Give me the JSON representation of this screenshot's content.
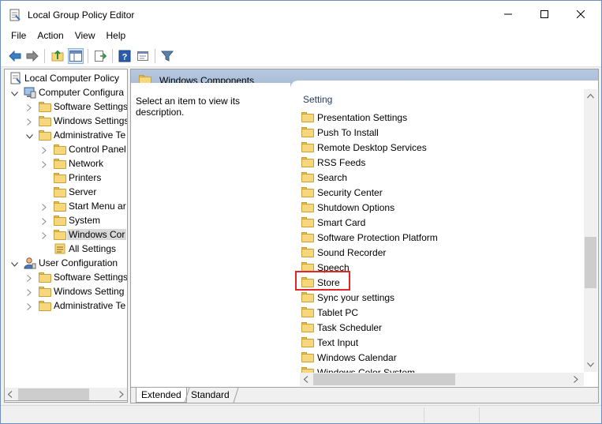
{
  "window": {
    "title": "Local Group Policy Editor",
    "controls": [
      "minimize",
      "maximize",
      "close"
    ]
  },
  "menu": [
    "File",
    "Action",
    "View",
    "Help"
  ],
  "toolbar": [
    "back-icon",
    "forward-icon",
    "up-folder-icon",
    "show-hide-tree-icon",
    "export-list-icon",
    "help-icon",
    "properties-icon",
    "filter-icon"
  ],
  "tree": [
    {
      "label": "Local Computer Policy",
      "icon": "policy-icon"
    },
    {
      "label": "Computer Configura",
      "icon": "computer-icon"
    },
    {
      "label": "Software Settings",
      "icon": "folder-icon"
    },
    {
      "label": "Windows Settings",
      "icon": "folder-icon"
    },
    {
      "label": "Administrative Te",
      "icon": "folder-icon"
    },
    {
      "label": "Control Panel",
      "icon": "folder-icon"
    },
    {
      "label": "Network",
      "icon": "folder-icon"
    },
    {
      "label": "Printers",
      "icon": "folder-icon"
    },
    {
      "label": "Server",
      "icon": "folder-icon"
    },
    {
      "label": "Start Menu ar",
      "icon": "folder-icon"
    },
    {
      "label": "System",
      "icon": "folder-icon"
    },
    {
      "label": "Windows Cor",
      "icon": "folder-icon",
      "selected": true
    },
    {
      "label": "All Settings",
      "icon": "all-settings-icon"
    },
    {
      "label": "User Configuration",
      "icon": "user-icon"
    },
    {
      "label": "Software Settings",
      "icon": "folder-icon"
    },
    {
      "label": "Windows Setting",
      "icon": "folder-icon"
    },
    {
      "label": "Administrative Te",
      "icon": "folder-icon"
    }
  ],
  "right_pane": {
    "header": "Windows Components",
    "description": "Select an item to view its description.",
    "column_header": "Setting",
    "items": [
      "Presentation Settings",
      "Push To Install",
      "Remote Desktop Services",
      "RSS Feeds",
      "Search",
      "Security Center",
      "Shutdown Options",
      "Smart Card",
      "Software Protection Platform",
      "Sound Recorder",
      "Speech",
      "Store",
      "Sync your settings",
      "Tablet PC",
      "Task Scheduler",
      "Text Input",
      "Windows Calendar",
      "Windows Color System"
    ],
    "highlighted_item": "Store",
    "highlight_color": "#e0262b"
  },
  "tabs": [
    {
      "label": "Extended",
      "active": true
    },
    {
      "label": "Standard",
      "active": false
    }
  ]
}
